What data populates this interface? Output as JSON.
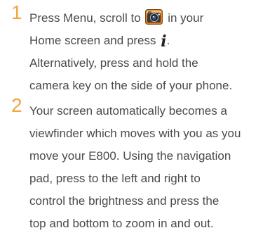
{
  "steps": [
    {
      "number": "1",
      "lines": {
        "l1_before": "Press Menu, scroll to",
        "l1_after": "in your",
        "l2_before": "Home screen and press",
        "l2_after": ".",
        "l3": "Alternatively, press and hold the",
        "l4": "camera key on the side of your phone."
      },
      "icons": {
        "camera": "camera-app-icon",
        "info": "info-key-icon",
        "info_glyph": "i"
      }
    },
    {
      "number": "2",
      "lines": [
        "Your screen automatically becomes a",
        "viewfinder which moves with you as you",
        "move your E800. Using the navigation",
        "pad, press to the left and right to",
        "control the brightness and press the",
        "top and bottom to zoom in and out."
      ]
    }
  ],
  "colors": {
    "step_number": "#f2a540",
    "body_text": "#4a4a4a"
  }
}
